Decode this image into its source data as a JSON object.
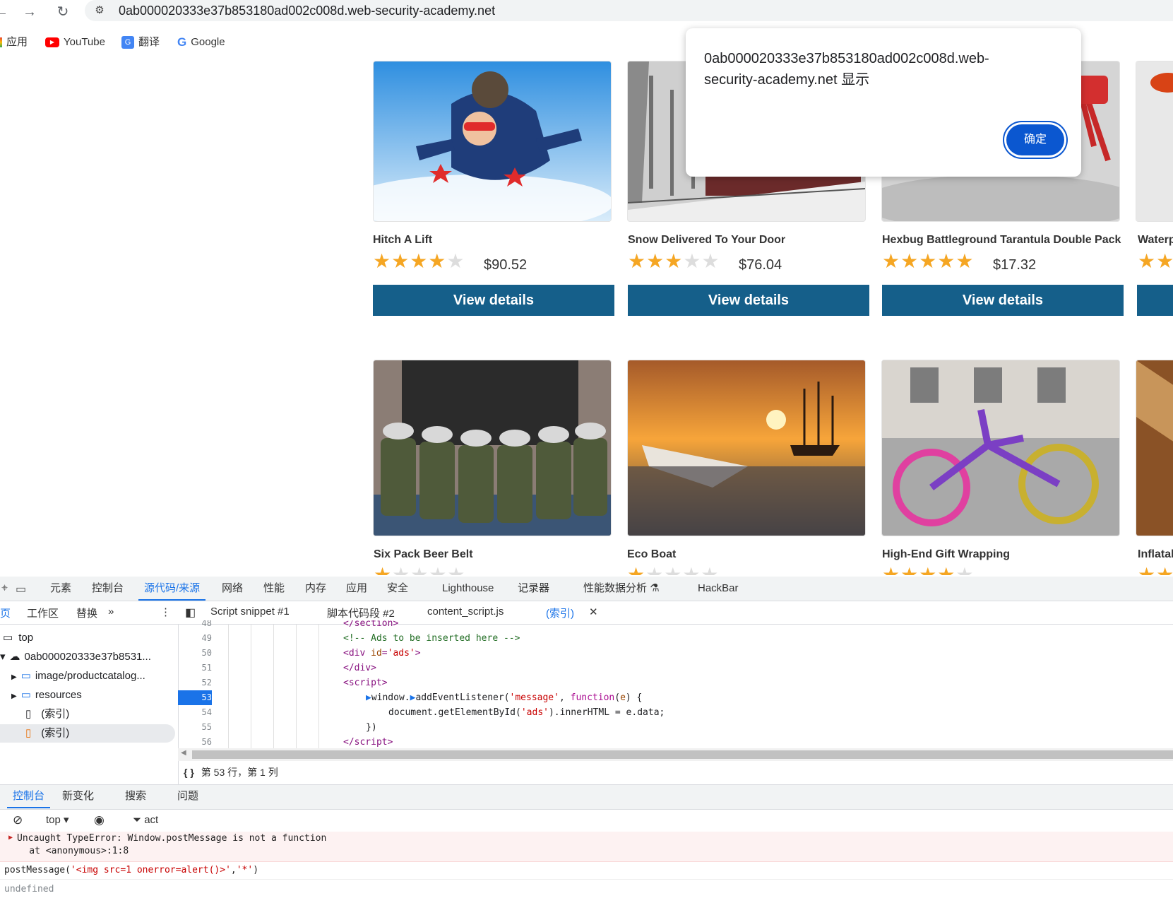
{
  "browser": {
    "url": "0ab000020333e37b853180ad002c008d.web-security-academy.net",
    "bookmarks": [
      "应用",
      "YouTube",
      "翻译",
      "Google"
    ]
  },
  "products": [
    {
      "name": "Hitch A Lift",
      "price": "$90.52",
      "rating": 4
    },
    {
      "name": "Snow Delivered To Your Door",
      "price": "$76.04",
      "rating": 3
    },
    {
      "name": "Hexbug Battleground Tarantula Double Pack",
      "price": "$17.32",
      "rating": 5
    },
    {
      "name": "Waterp",
      "rating": 2
    },
    {
      "name": "Six Pack Beer Belt",
      "rating": 1
    },
    {
      "name": "Eco Boat",
      "rating": 1
    },
    {
      "name": "High-End Gift Wrapping",
      "rating": 4
    },
    {
      "name": "Inflatal",
      "rating": 1
    }
  ],
  "view_details_label": "View details",
  "dialog": {
    "message_line1": "0ab000020333e37b853180ad002c008d.web-",
    "message_line2": "security-academy.net 显示",
    "ok_label": "确定"
  },
  "devtools": {
    "tabs": [
      "元素",
      "控制台",
      "源代码/来源",
      "网络",
      "性能",
      "内存",
      "应用",
      "安全",
      "Lighthouse",
      "记录器",
      "性能数据分析",
      "HackBar"
    ],
    "active_tab": "源代码/来源",
    "nav_subtabs": [
      "页",
      "工作区",
      "替换"
    ],
    "tree": [
      "top",
      "0ab000020333e37b8531...",
      "image/productcatalog...",
      "resources",
      "(索引)",
      "(索引)"
    ],
    "editor_tabs": [
      "Script snippet #1",
      "脚本代码段 #2",
      "content_script.js",
      "(索引)"
    ],
    "line_numbers": [
      "48",
      "49",
      "50",
      "51",
      "52",
      "53",
      "54",
      "55",
      "56"
    ],
    "status": "第 53 行，第 1 列",
    "drawer_tabs": [
      "控制台",
      "新变化",
      "搜索",
      "问题"
    ],
    "console_context": "top",
    "console_filter": "act",
    "error_line1": "Uncaught TypeError: Window.postMessage is not a function",
    "error_line2": "    at <anonymous>:1:8",
    "input_line": "postMessage('<img src=1 onerror=alert()>','*')",
    "result_line": "undefined"
  },
  "colors": {
    "accent": "#1a73e8",
    "button": "#155f8a",
    "star": "#f5a623"
  }
}
